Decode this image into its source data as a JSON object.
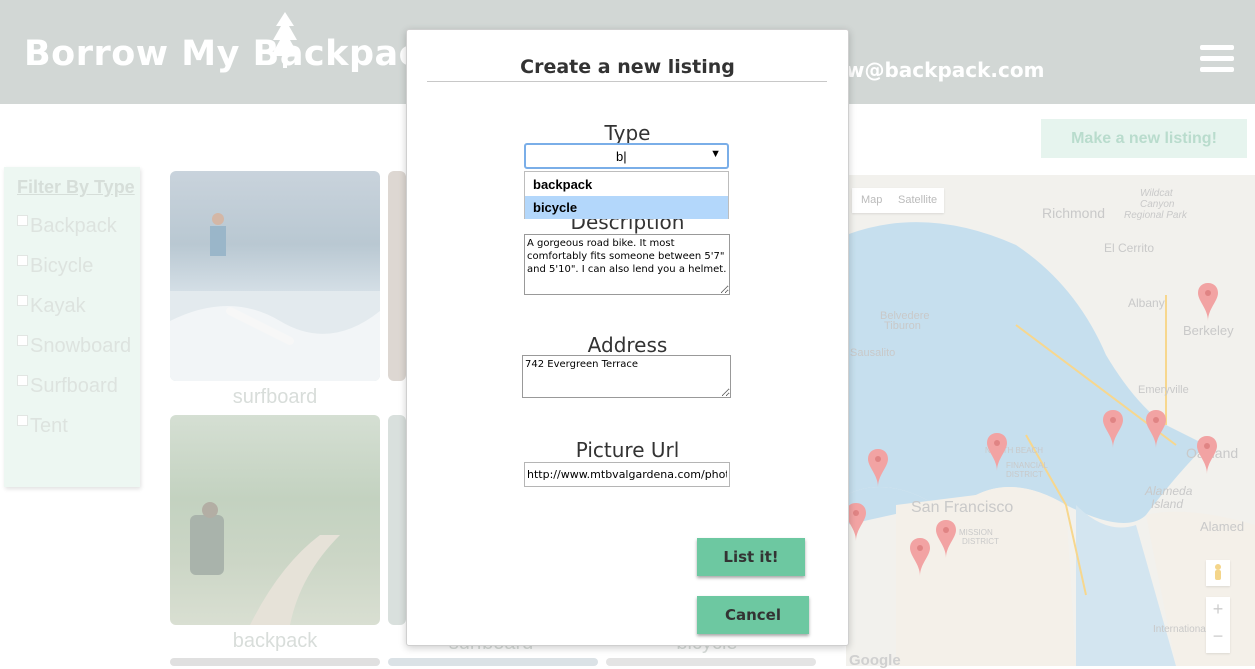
{
  "header": {
    "brand": "Borrow My Backpack",
    "email": "w@backpack.com"
  },
  "actions": {
    "make_listing": "Make a new listing!"
  },
  "filter": {
    "title": "Filter By Type",
    "items": [
      "Backpack",
      "Bicycle",
      "Kayak",
      "Snowboard",
      "Surfboard",
      "Tent"
    ]
  },
  "cards": [
    {
      "label": "surfboard"
    },
    {
      "label": "backpack"
    },
    {
      "label": "surfboard"
    },
    {
      "label": "bicycle"
    }
  ],
  "map": {
    "tabs": [
      "Map",
      "Satellite"
    ],
    "labels": [
      "Richmond",
      "El Cerrito",
      "Albany",
      "Berkeley",
      "Belvedere",
      "Tiburon",
      "Sausalito",
      "Emeryville",
      "Oakland",
      "San Francisco",
      "Alameda",
      "Island",
      "FINANCIAL",
      "DISTRICT",
      "MISSION",
      "DISTRICT",
      "NORTH BEACH",
      "Wildcat",
      "Canyon",
      "Regional Park",
      "International",
      "Alamed",
      "Google"
    ],
    "zoom_in": "+",
    "zoom_out": "−"
  },
  "modal": {
    "title": "Create a new listing",
    "type_label": "Type",
    "type_value": "b|",
    "type_options": [
      "backpack",
      "bicycle"
    ],
    "selected_option": "bicycle",
    "description_label": "Description",
    "description_value": "A gorgeous road bike. It most comfortably fits someone between 5'7\" and 5'10\". I can also lend you a helmet.",
    "address_label": "Address",
    "address_value": "742 Evergreen Terrace",
    "picture_label": "Picture Url",
    "picture_value": "http://www.mtbvalgardena.com/photos",
    "list_button": "List it!",
    "cancel_button": "Cancel"
  }
}
